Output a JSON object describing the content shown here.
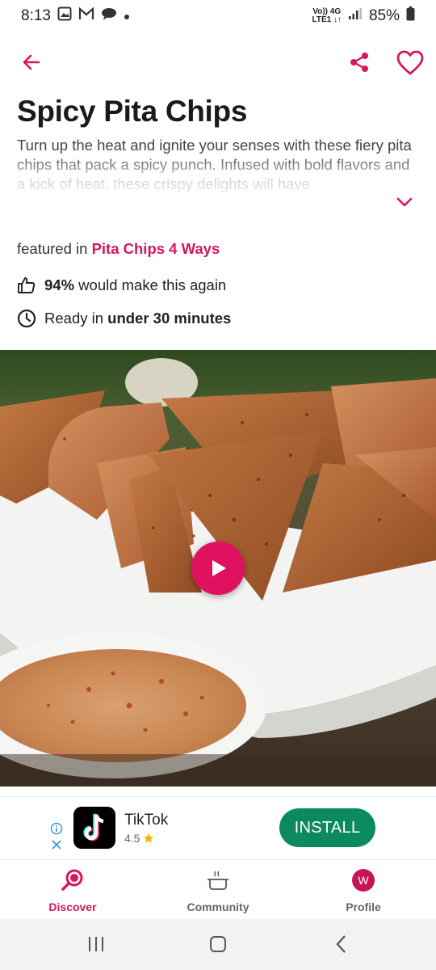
{
  "status_bar": {
    "time": "8:13",
    "network_top": "Vo)) 4G",
    "network_bottom": "LTE1 ↓↑",
    "battery": "85%"
  },
  "recipe": {
    "title": "Spicy Pita Chips",
    "description": "Turn up the heat and ignite your senses with these fiery pita chips that pack a spicy punch. Infused with bold flavors and a kick of heat, these crispy delights will have",
    "featured_prefix": "featured in",
    "featured_link": "Pita Chips 4 Ways",
    "rating_percent": "94%",
    "rating_suffix": "would make this again",
    "ready_prefix": "Ready in",
    "ready_time": "under 30 minutes"
  },
  "ad": {
    "app_name": "TikTok",
    "rating": "4.5",
    "install_label": "INSTALL"
  },
  "bottom_nav": {
    "discover": "Discover",
    "community": "Community",
    "profile": "Profile",
    "avatar_initial": "W"
  },
  "icons": {
    "back": "arrow-left-icon",
    "share": "share-icon",
    "favorite": "heart-icon",
    "expand": "chevron-down-icon",
    "thumbs_up": "thumbs-up-icon",
    "clock": "clock-icon",
    "play": "play-icon"
  },
  "colors": {
    "accent": "#d5175b",
    "install": "#0b8a5d"
  }
}
